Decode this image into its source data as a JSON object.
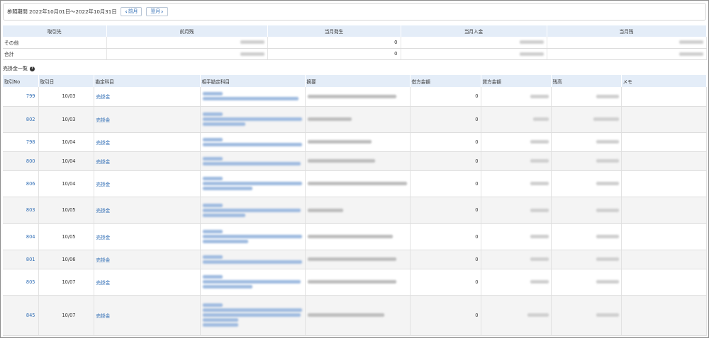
{
  "period": {
    "label": "参照期間 2022年10月01日～2022年10月31日",
    "prev_label": "前月",
    "next_label": "翌月"
  },
  "summary": {
    "headers": [
      "取引先",
      "前月残",
      "当月発生",
      "当月入金",
      "当月残"
    ],
    "rows": [
      {
        "name": "その他",
        "hatsusei": "0"
      },
      {
        "name": "合計",
        "hatsusei": "0"
      }
    ]
  },
  "section": {
    "title": "売掛金一覧"
  },
  "detail": {
    "headers": [
      "取引No",
      "取引日",
      "勘定科目",
      "相手勘定科目",
      "摘要",
      "借方金額",
      "貸方金額",
      "残高",
      "メモ"
    ],
    "rows": [
      {
        "no": "799",
        "date": "10/03",
        "account": "売掛金",
        "debit": "0"
      },
      {
        "no": "802",
        "date": "10/03",
        "account": "売掛金",
        "debit": "0"
      },
      {
        "no": "798",
        "date": "10/04",
        "account": "売掛金",
        "debit": "0"
      },
      {
        "no": "800",
        "date": "10/04",
        "account": "売掛金",
        "debit": "0"
      },
      {
        "no": "806",
        "date": "10/04",
        "account": "売掛金",
        "debit": "0"
      },
      {
        "no": "803",
        "date": "10/05",
        "account": "売掛金",
        "debit": "0"
      },
      {
        "no": "804",
        "date": "10/05",
        "account": "売掛金",
        "debit": "0"
      },
      {
        "no": "801",
        "date": "10/06",
        "account": "売掛金",
        "debit": "0"
      },
      {
        "no": "805",
        "date": "10/07",
        "account": "売掛金",
        "debit": "0"
      },
      {
        "no": "845",
        "date": "10/07",
        "account": "売掛金",
        "debit": "0"
      }
    ]
  },
  "colors": {
    "header_bg": "#e4edf8",
    "link": "#2f6db5",
    "alt_row": "#f4f4f4"
  },
  "icons": {
    "prev": "chevron-left-icon",
    "next": "chevron-right-icon",
    "help": "question-circle-icon"
  }
}
